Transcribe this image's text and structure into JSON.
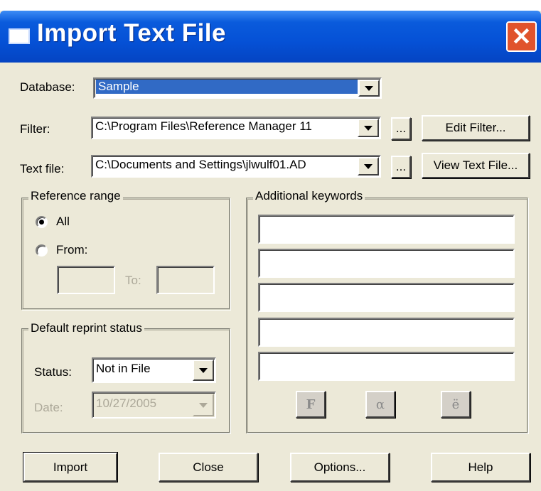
{
  "window": {
    "title": "Import Text File",
    "close_glyph": "✕"
  },
  "database": {
    "label": "Database:",
    "value": "Sample"
  },
  "filter": {
    "label": "Filter:",
    "value": "C:\\Program Files\\Reference Manager 11",
    "browse_label": "...",
    "edit_label": "Edit Filter..."
  },
  "textfile": {
    "label": "Text file:",
    "value": "C:\\Documents and Settings\\jlwulf01.AD",
    "browse_label": "...",
    "view_label": "View Text File..."
  },
  "reference_range": {
    "legend": "Reference range",
    "all_label": "All",
    "from_label": "From:",
    "to_label": "To:",
    "selected": "All"
  },
  "reprint": {
    "legend": "Default reprint status",
    "status_label": "Status:",
    "status_value": "Not in File",
    "date_label": "Date:",
    "date_value": "10/27/2005"
  },
  "keywords": {
    "legend": "Additional keywords",
    "fields": [
      "",
      "",
      "",
      "",
      ""
    ],
    "symbol_buttons": [
      "F",
      "α",
      "ë"
    ]
  },
  "footer": {
    "import_label": "Import",
    "close_label": "Close",
    "options_label": "Options...",
    "help_label": "Help"
  },
  "colors": {
    "dialog_bg": "#ece9d8",
    "title_blue": "#0551d6",
    "close_red": "#e0532c",
    "selection": "#316ac5"
  },
  "icons": {
    "title": "window-icon",
    "close": "close-icon",
    "dropdown": "chevron-down-icon"
  }
}
